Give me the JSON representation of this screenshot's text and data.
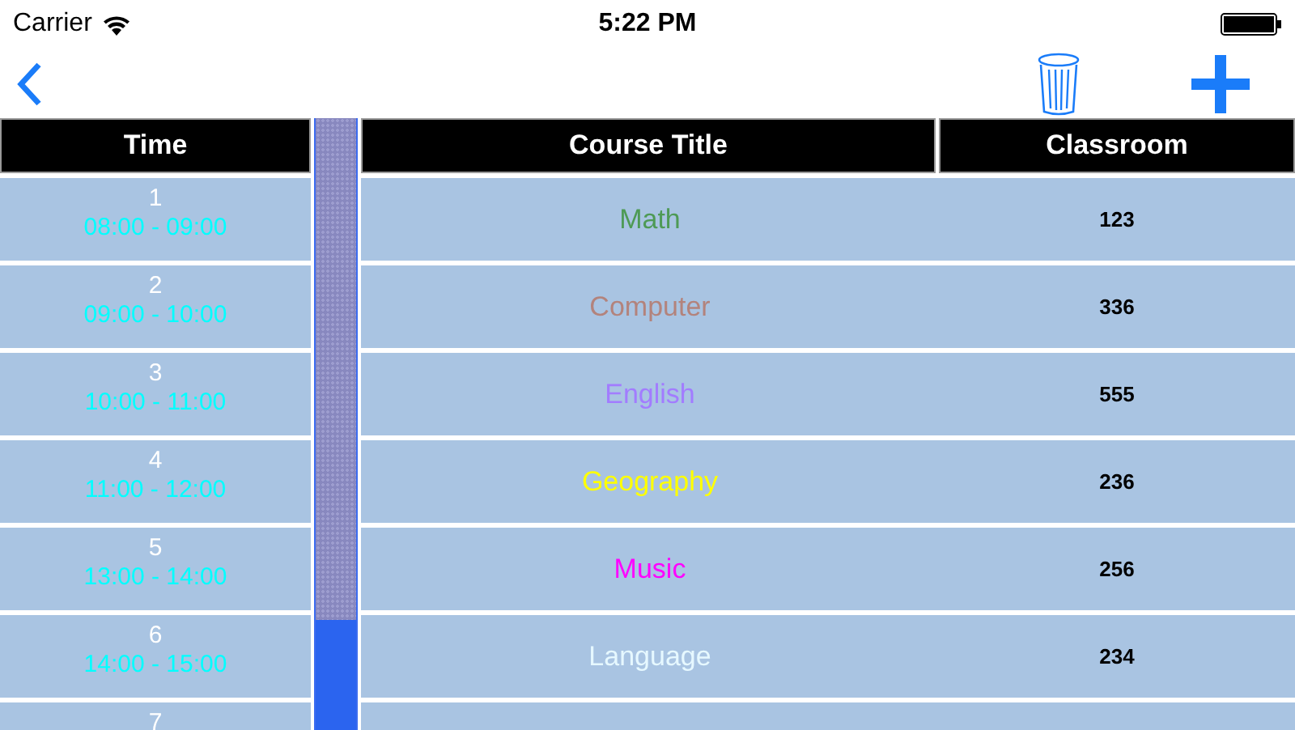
{
  "status_bar": {
    "carrier": "Carrier",
    "time": "5:22 PM"
  },
  "table": {
    "columns": [
      "Time",
      "Course Title",
      "Classroom"
    ],
    "rows": [
      {
        "period": "1",
        "time": "08:00 - 09:00",
        "course": "Math",
        "color": "#4e9a55",
        "classroom": "123"
      },
      {
        "period": "2",
        "time": "09:00 - 10:00",
        "course": "Computer",
        "color": "#b3837c",
        "classroom": "336"
      },
      {
        "period": "3",
        "time": "10:00 - 11:00",
        "course": "English",
        "color": "#a27cff",
        "classroom": "555"
      },
      {
        "period": "4",
        "time": "11:00 - 12:00",
        "course": "Geography",
        "color": "#ffff00",
        "classroom": "236"
      },
      {
        "period": "5",
        "time": "13:00 - 14:00",
        "course": "Music",
        "color": "#ff00ff",
        "classroom": "256"
      },
      {
        "period": "6",
        "time": "14:00 - 15:00",
        "course": "Language",
        "color": "#e6f8ff",
        "classroom": "234"
      },
      {
        "period": "7"
      }
    ]
  }
}
